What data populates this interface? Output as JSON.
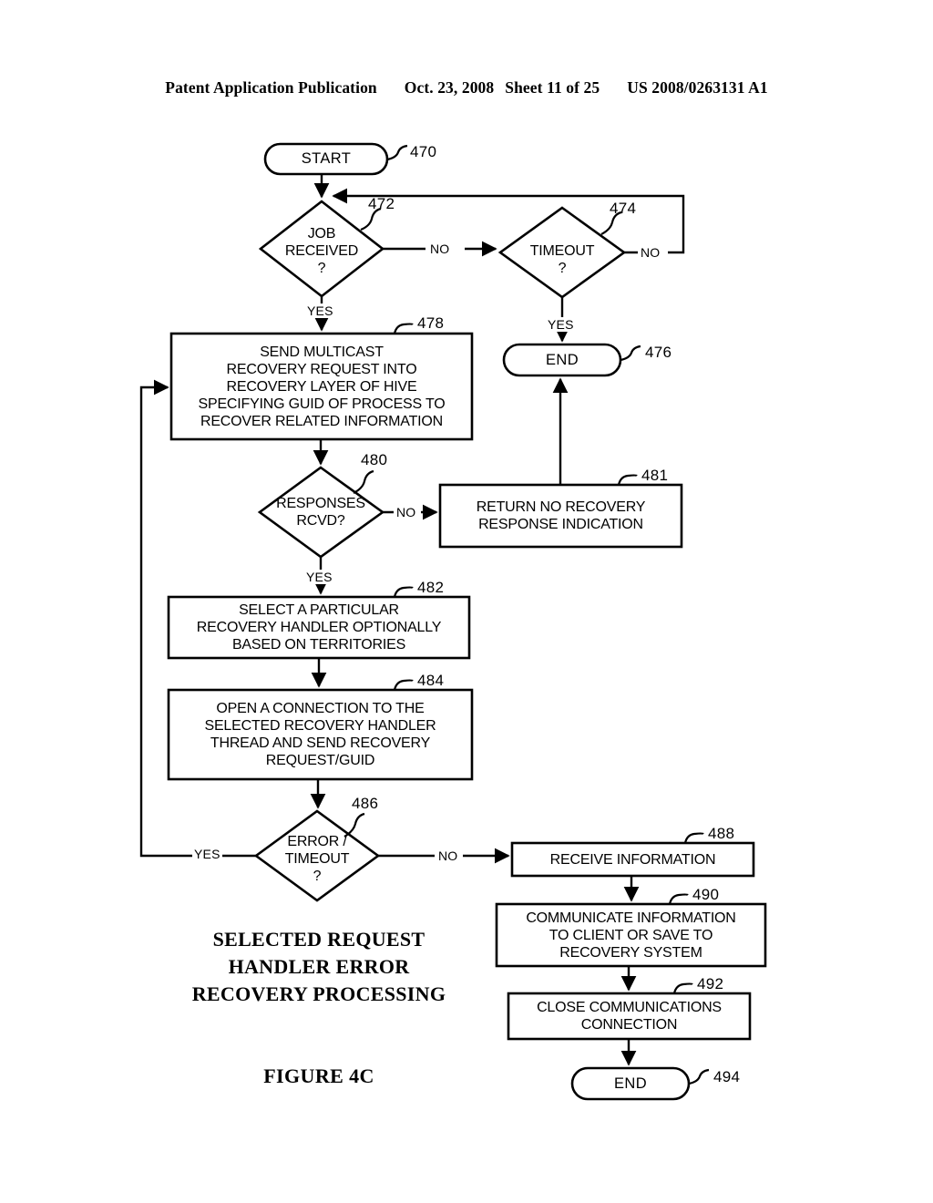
{
  "header": {
    "publication": "Patent Application Publication",
    "date": "Oct. 23, 2008",
    "sheet": "Sheet 11 of 25",
    "document_number": "US 2008/0263131 A1"
  },
  "figure": {
    "caption": "SELECTED\nREQUEST HANDLER\nERROR RECOVERY\nPROCESSING",
    "number": "FIGURE 4C"
  },
  "nodes": {
    "n470": {
      "label": "START",
      "ref": "470",
      "type": "terminal"
    },
    "n472": {
      "label": "JOB\nRECEIVED\n?",
      "ref": "472",
      "type": "decision"
    },
    "n474": {
      "label": "TIMEOUT\n?",
      "ref": "474",
      "type": "decision"
    },
    "n476": {
      "label": "END",
      "ref": "476",
      "type": "terminal"
    },
    "n478": {
      "label": "SEND MULTICAST\nRECOVERY REQUEST INTO\nRECOVERY LAYER OF HIVE\nSPECIFYING GUID OF PROCESS TO\nRECOVER RELATED INFORMATION",
      "ref": "478",
      "type": "process"
    },
    "n480": {
      "label": "RESPONSES\nRCVD?",
      "ref": "480",
      "type": "decision"
    },
    "n481": {
      "label": "RETURN NO RECOVERY\nRESPONSE INDICATION",
      "ref": "481",
      "type": "process"
    },
    "n482": {
      "label": "SELECT A PARTICULAR\nRECOVERY HANDLER OPTIONALLY\nBASED ON TERRITORIES",
      "ref": "482",
      "type": "process"
    },
    "n484": {
      "label": "OPEN A CONNECTION TO THE\nSELECTED RECOVERY HANDLER\nTHREAD AND SEND RECOVERY\nREQUEST/GUID",
      "ref": "484",
      "type": "process"
    },
    "n486": {
      "label": "ERROR /\nTIMEOUT\n?",
      "ref": "486",
      "type": "decision"
    },
    "n488": {
      "label": "RECEIVE INFORMATION",
      "ref": "488",
      "type": "process"
    },
    "n490": {
      "label": "COMMUNICATE INFORMATION\nTO CLIENT OR SAVE TO\nRECOVERY SYSTEM",
      "ref": "490",
      "type": "process"
    },
    "n492": {
      "label": "CLOSE COMMUNICATIONS\nCONNECTION",
      "ref": "492",
      "type": "process"
    },
    "n494": {
      "label": "END",
      "ref": "494",
      "type": "terminal"
    }
  },
  "edges": {
    "e472_no": "NO",
    "e472_yes": "YES",
    "e474_no": "NO",
    "e474_yes": "YES",
    "e480_no": "NO",
    "e480_yes": "YES",
    "e486_no": "NO",
    "e486_yes": "YES"
  },
  "colors": {
    "ink": "#000000",
    "paper": "#ffffff"
  }
}
